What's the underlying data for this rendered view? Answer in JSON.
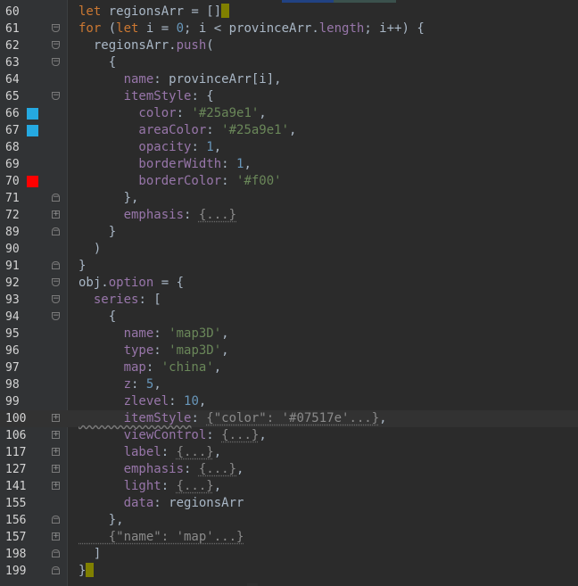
{
  "editor": {
    "colors": {
      "background": "#2b2b2b",
      "keyword": "#cc7832",
      "string": "#6a8759",
      "number": "#6897bb",
      "property": "#9876aa",
      "marker_blue": "#25a9e1",
      "marker_red": "#ff0000"
    },
    "lines": [
      {
        "num": "60",
        "marker": "",
        "fold": "",
        "tokens": [
          [
            "kw",
            "let "
          ],
          [
            "plain",
            "regionsArr = []"
          ],
          [
            "caret",
            ""
          ]
        ]
      },
      {
        "num": "61",
        "marker": "",
        "fold": "open",
        "tokens": [
          [
            "kw",
            "for "
          ],
          [
            "plain",
            "("
          ],
          [
            "kw",
            "let "
          ],
          [
            "plain",
            "i = "
          ],
          [
            "num",
            "0"
          ],
          [
            "plain",
            "; i < provinceArr."
          ],
          [
            "prop",
            "length"
          ],
          [
            "plain",
            "; i++) {"
          ]
        ]
      },
      {
        "num": "62",
        "marker": "",
        "fold": "open",
        "tokens": [
          [
            "plain",
            "  regionsArr."
          ],
          [
            "prop",
            "push"
          ],
          [
            "plain",
            "("
          ]
        ]
      },
      {
        "num": "63",
        "marker": "",
        "fold": "open",
        "tokens": [
          [
            "plain",
            "    {"
          ]
        ]
      },
      {
        "num": "64",
        "marker": "",
        "fold": "",
        "tokens": [
          [
            "prop",
            "      name"
          ],
          [
            "plain",
            ": provinceArr[i],"
          ]
        ]
      },
      {
        "num": "65",
        "marker": "",
        "fold": "open",
        "tokens": [
          [
            "prop",
            "      itemStyle"
          ],
          [
            "plain",
            ": {"
          ]
        ]
      },
      {
        "num": "66",
        "marker": "blue",
        "fold": "",
        "tokens": [
          [
            "prop",
            "        color"
          ],
          [
            "plain",
            ": "
          ],
          [
            "str",
            "'#25a9e1'"
          ],
          [
            "plain",
            ","
          ]
        ]
      },
      {
        "num": "67",
        "marker": "blue",
        "fold": "",
        "tokens": [
          [
            "prop",
            "        areaColor"
          ],
          [
            "plain",
            ": "
          ],
          [
            "str",
            "'#25a9e1'"
          ],
          [
            "plain",
            ","
          ]
        ]
      },
      {
        "num": "68",
        "marker": "",
        "fold": "",
        "tokens": [
          [
            "prop",
            "        opacity"
          ],
          [
            "plain",
            ": "
          ],
          [
            "num",
            "1"
          ],
          [
            "plain",
            ","
          ]
        ]
      },
      {
        "num": "69",
        "marker": "",
        "fold": "",
        "tokens": [
          [
            "prop",
            "        borderWidth"
          ],
          [
            "plain",
            ": "
          ],
          [
            "num",
            "1"
          ],
          [
            "plain",
            ","
          ]
        ]
      },
      {
        "num": "70",
        "marker": "red",
        "fold": "",
        "tokens": [
          [
            "prop",
            "        borderColor"
          ],
          [
            "plain",
            ": "
          ],
          [
            "str",
            "'#f00'"
          ]
        ]
      },
      {
        "num": "71",
        "marker": "",
        "fold": "close",
        "tokens": [
          [
            "plain",
            "      },"
          ]
        ]
      },
      {
        "num": "72",
        "marker": "",
        "fold": "plus",
        "tokens": [
          [
            "prop",
            "      emphasis"
          ],
          [
            "plain",
            ": "
          ],
          [
            "folded",
            "{...}"
          ]
        ]
      },
      {
        "num": "89",
        "marker": "",
        "fold": "close",
        "tokens": [
          [
            "plain",
            "    }"
          ]
        ]
      },
      {
        "num": "90",
        "marker": "",
        "fold": "",
        "tokens": [
          [
            "plain",
            "  )"
          ]
        ]
      },
      {
        "num": "91",
        "marker": "",
        "fold": "close",
        "tokens": [
          [
            "plain",
            "}"
          ]
        ]
      },
      {
        "num": "92",
        "marker": "",
        "fold": "open",
        "tokens": [
          [
            "plain",
            "obj."
          ],
          [
            "prop",
            "option"
          ],
          [
            "plain",
            " = {"
          ]
        ]
      },
      {
        "num": "93",
        "marker": "",
        "fold": "open",
        "tokens": [
          [
            "prop",
            "  series"
          ],
          [
            "plain",
            ": ["
          ]
        ]
      },
      {
        "num": "94",
        "marker": "",
        "fold": "open",
        "tokens": [
          [
            "plain",
            "    {"
          ]
        ]
      },
      {
        "num": "95",
        "marker": "",
        "fold": "",
        "tokens": [
          [
            "prop",
            "      name"
          ],
          [
            "plain",
            ": "
          ],
          [
            "str",
            "'map3D'"
          ],
          [
            "plain",
            ","
          ]
        ]
      },
      {
        "num": "96",
        "marker": "",
        "fold": "",
        "tokens": [
          [
            "prop",
            "      type"
          ],
          [
            "plain",
            ": "
          ],
          [
            "str",
            "'map3D'"
          ],
          [
            "plain",
            ","
          ]
        ]
      },
      {
        "num": "97",
        "marker": "",
        "fold": "",
        "tokens": [
          [
            "prop",
            "      map"
          ],
          [
            "plain",
            ": "
          ],
          [
            "str",
            "'china'"
          ],
          [
            "plain",
            ","
          ]
        ]
      },
      {
        "num": "98",
        "marker": "",
        "fold": "",
        "tokens": [
          [
            "prop",
            "      z"
          ],
          [
            "plain",
            ": "
          ],
          [
            "num",
            "5"
          ],
          [
            "plain",
            ","
          ]
        ]
      },
      {
        "num": "99",
        "marker": "",
        "fold": "",
        "tokens": [
          [
            "prop",
            "      zlevel"
          ],
          [
            "plain",
            ": "
          ],
          [
            "num",
            "10"
          ],
          [
            "plain",
            ","
          ]
        ]
      },
      {
        "num": "100",
        "marker": "",
        "fold": "plus",
        "current": true,
        "tokens": [
          [
            "prop-squiggle",
            "      itemStyle"
          ],
          [
            "plain",
            ": "
          ],
          [
            "folded",
            "{\"color\": '#07517e'...}"
          ],
          [
            "plain",
            ","
          ]
        ]
      },
      {
        "num": "106",
        "marker": "",
        "fold": "plus",
        "tokens": [
          [
            "prop",
            "      viewControl"
          ],
          [
            "plain",
            ": "
          ],
          [
            "folded",
            "{...}"
          ],
          [
            "plain",
            ","
          ]
        ]
      },
      {
        "num": "117",
        "marker": "",
        "fold": "plus",
        "tokens": [
          [
            "prop",
            "      label"
          ],
          [
            "plain",
            ": "
          ],
          [
            "folded",
            "{...}"
          ],
          [
            "plain",
            ","
          ]
        ]
      },
      {
        "num": "127",
        "marker": "",
        "fold": "plus",
        "tokens": [
          [
            "prop",
            "      emphasis"
          ],
          [
            "plain",
            ": "
          ],
          [
            "folded",
            "{...}"
          ],
          [
            "plain",
            ","
          ]
        ]
      },
      {
        "num": "141",
        "marker": "",
        "fold": "plus",
        "tokens": [
          [
            "prop",
            "      light"
          ],
          [
            "plain",
            ": "
          ],
          [
            "folded",
            "{...}"
          ],
          [
            "plain",
            ","
          ]
        ]
      },
      {
        "num": "155",
        "marker": "",
        "fold": "",
        "tokens": [
          [
            "prop",
            "      data"
          ],
          [
            "plain",
            ": regionsArr"
          ]
        ]
      },
      {
        "num": "156",
        "marker": "",
        "fold": "close",
        "tokens": [
          [
            "plain",
            "    },"
          ]
        ]
      },
      {
        "num": "157",
        "marker": "",
        "fold": "plus",
        "tokens": [
          [
            "folded",
            "    {\"name\": 'map'...}"
          ]
        ]
      },
      {
        "num": "198",
        "marker": "",
        "fold": "close",
        "tokens": [
          [
            "plain",
            "  ]"
          ]
        ]
      },
      {
        "num": "199",
        "marker": "",
        "fold": "close",
        "tokens": [
          [
            "plain",
            "}"
          ],
          [
            "caret",
            ""
          ]
        ]
      }
    ]
  }
}
